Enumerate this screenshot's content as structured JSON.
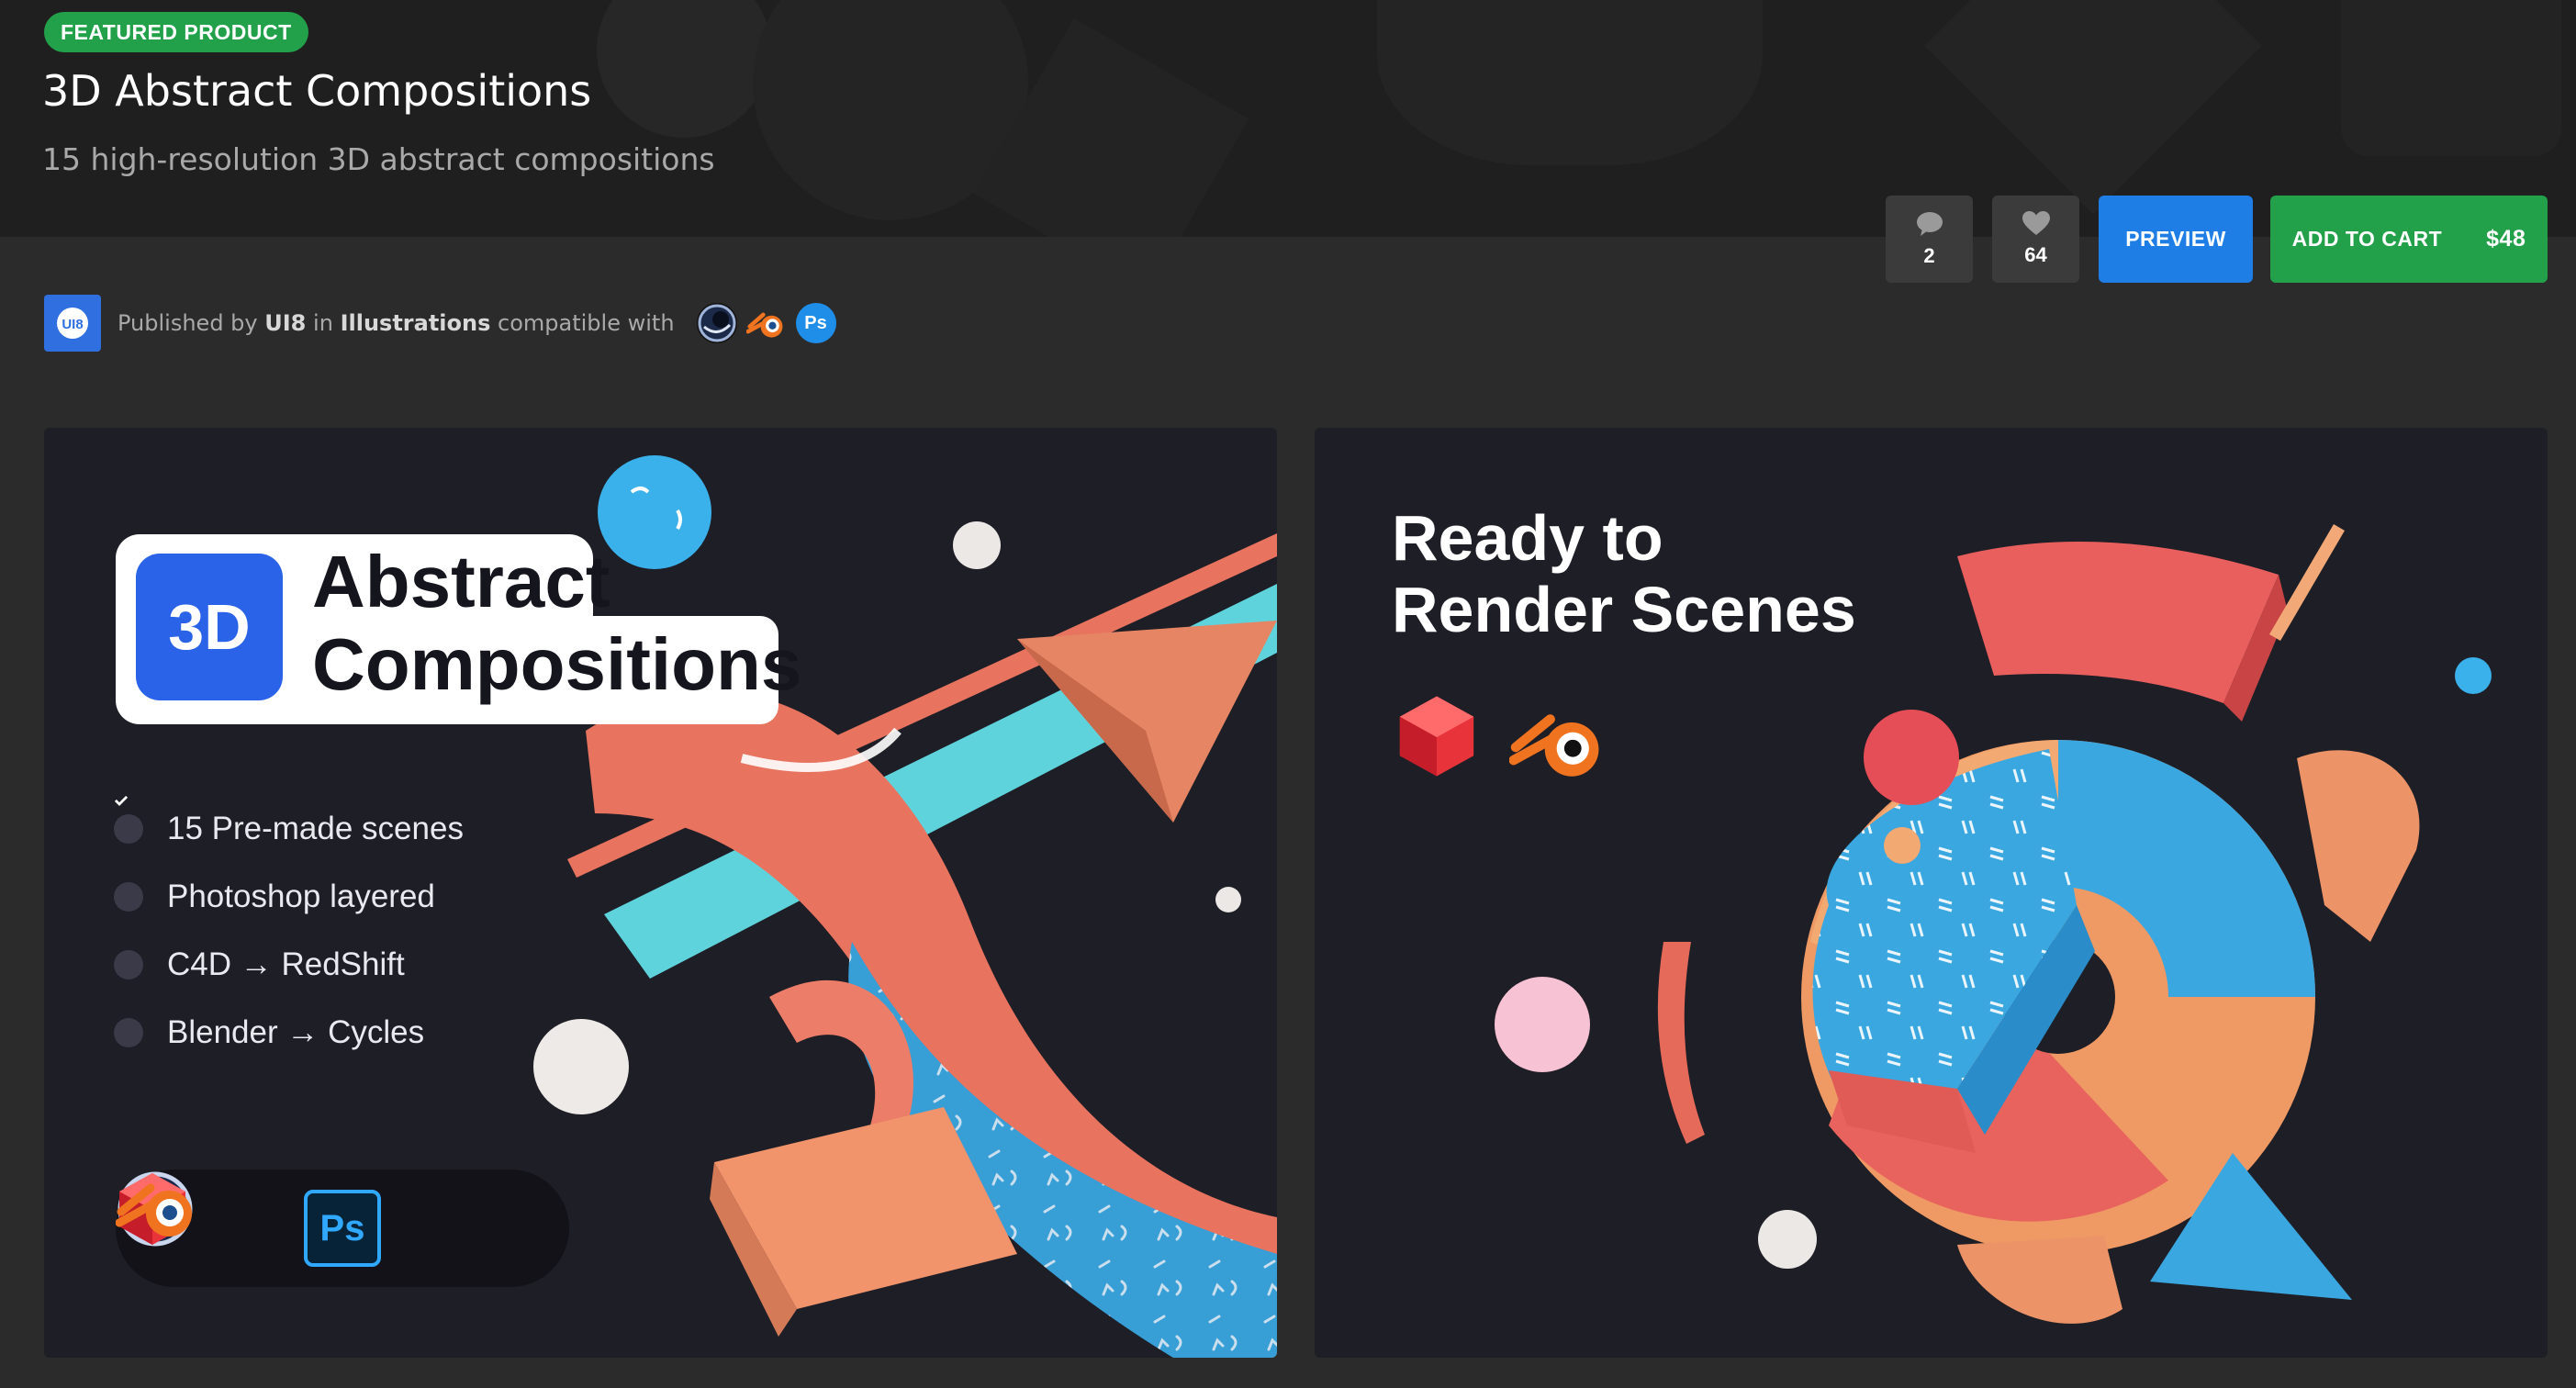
{
  "header": {
    "badge": "FEATURED PRODUCT",
    "title": "3D Abstract Compositions",
    "subtitle": "15 high-resolution 3D abstract compositions",
    "comments_count": "2",
    "likes_count": "64",
    "preview_label": "PREVIEW",
    "cart_label": "ADD TO CART",
    "price": "$48"
  },
  "publisher": {
    "logo_text": "UI8",
    "published_by": "Published by",
    "author": "UI8",
    "in_word": "in",
    "category": "Illustrations",
    "compatible_with": "compatible with",
    "compatible_icons": [
      "cinema4d-icon",
      "blender-icon",
      "photoshop-icon"
    ]
  },
  "preview_left": {
    "badge": "3D",
    "title_line1": "Abstract",
    "title_line2": "Compositions",
    "features": [
      "15 Pre-made scenes",
      "Photoshop layered",
      "C4D → RedShift",
      "Blender → Cycles"
    ],
    "tool_icons": [
      "cinema4d-icon",
      "redshift-icon",
      "blender-icon",
      "photoshop-icon"
    ],
    "ps_label": "Ps"
  },
  "preview_right": {
    "title_line1": "Ready to",
    "title_line2": "Render Scenes",
    "tool_icons": [
      "redshift-icon",
      "blender-icon"
    ]
  },
  "colors": {
    "green": "#22a14a",
    "blue": "#1e7ee6",
    "brand_blue": "#2a62e8",
    "coral": "#e8735f",
    "sky": "#3ba7e0",
    "cyan": "#5fd3dc",
    "peach": "#f0a06d"
  }
}
